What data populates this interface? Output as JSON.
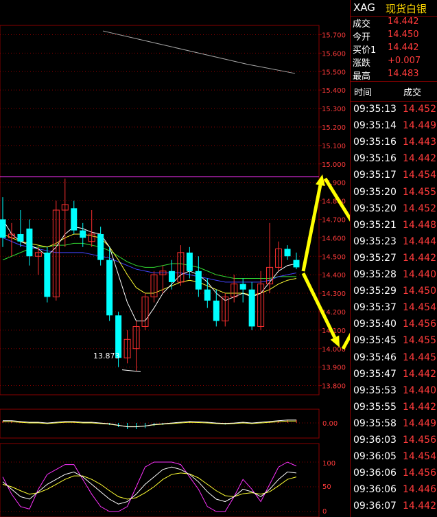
{
  "header": {
    "symbol": "XAG",
    "name": "现货白银"
  },
  "quote": [
    {
      "label": "成交",
      "value": "14.442"
    },
    {
      "label": "今开",
      "value": "14.450"
    },
    {
      "label": "买价1",
      "value": "14.442"
    },
    {
      "label": "涨跌",
      "value": "+0.007"
    },
    {
      "label": "最高",
      "value": "14.483"
    }
  ],
  "ticks_header": {
    "time": "时间",
    "price": "成交"
  },
  "ticks": [
    {
      "time": "09:35:13",
      "price": "14.452"
    },
    {
      "time": "09:35:14",
      "price": "14.449"
    },
    {
      "time": "09:35:16",
      "price": "14.443"
    },
    {
      "time": "09:35:16",
      "price": "14.442"
    },
    {
      "time": "09:35:17",
      "price": "14.454"
    },
    {
      "time": "09:35:20",
      "price": "14.455"
    },
    {
      "time": "09:35:20",
      "price": "14.452"
    },
    {
      "time": "09:35:21",
      "price": "14.448"
    },
    {
      "time": "09:35:23",
      "price": "14.444"
    },
    {
      "time": "09:35:27",
      "price": "14.442"
    },
    {
      "time": "09:35:28",
      "price": "14.440"
    },
    {
      "time": "09:35:29",
      "price": "14.450"
    },
    {
      "time": "09:35:37",
      "price": "14.454"
    },
    {
      "time": "09:35:40",
      "price": "14.456"
    },
    {
      "time": "09:35:45",
      "price": "14.455"
    },
    {
      "time": "09:35:46",
      "price": "14.445"
    },
    {
      "time": "09:35:47",
      "price": "14.442"
    },
    {
      "time": "09:35:53",
      "price": "14.440"
    },
    {
      "time": "09:35:55",
      "price": "14.442"
    },
    {
      "time": "09:35:58",
      "price": "14.449"
    },
    {
      "time": "09:36:03",
      "price": "14.456"
    },
    {
      "time": "09:36:05",
      "price": "14.454"
    },
    {
      "time": "09:36:06",
      "price": "14.456"
    },
    {
      "time": "09:36:06",
      "price": "14.446"
    },
    {
      "time": "09:36:07",
      "price": "14.442"
    }
  ],
  "chart": {
    "price_axis": [
      "15.700",
      "15.600",
      "15.500",
      "15.400",
      "15.300",
      "15.200",
      "15.100",
      "15.000",
      "14.900",
      "14.800",
      "14.700",
      "14.600",
      "14.500",
      "14.400",
      "14.300",
      "14.200",
      "14.100",
      "14.000",
      "13.900",
      "13.800"
    ],
    "low_label": "13.873",
    "macd_axis": [
      "0.00"
    ],
    "kdj_axis": [
      "100",
      "50",
      "0"
    ],
    "colors": {
      "up": "#ff3030",
      "down": "#00ffff",
      "grid": "#8a0000",
      "arrow": "#ffff00"
    }
  },
  "chart_data": {
    "type": "candlestick",
    "ylim": [
      13.75,
      15.75
    ],
    "candles": [
      {
        "o": 14.7,
        "h": 14.82,
        "l": 14.55,
        "c": 14.6
      },
      {
        "o": 14.6,
        "h": 14.68,
        "l": 14.5,
        "c": 14.62
      },
      {
        "o": 14.62,
        "h": 14.75,
        "l": 14.55,
        "c": 14.58
      },
      {
        "o": 14.65,
        "h": 14.7,
        "l": 14.45,
        "c": 14.5
      },
      {
        "o": 14.5,
        "h": 14.55,
        "l": 14.4,
        "c": 14.52
      },
      {
        "o": 14.52,
        "h": 14.55,
        "l": 14.25,
        "c": 14.28
      },
      {
        "o": 14.28,
        "h": 14.8,
        "l": 14.26,
        "c": 14.75
      },
      {
        "o": 14.75,
        "h": 14.92,
        "l": 14.55,
        "c": 14.78
      },
      {
        "o": 14.76,
        "h": 14.8,
        "l": 14.62,
        "c": 14.64
      },
      {
        "o": 14.64,
        "h": 14.68,
        "l": 14.55,
        "c": 14.6
      },
      {
        "o": 14.58,
        "h": 14.75,
        "l": 14.55,
        "c": 14.62
      },
      {
        "o": 14.62,
        "h": 14.66,
        "l": 14.45,
        "c": 14.48
      },
      {
        "o": 14.48,
        "h": 14.55,
        "l": 14.15,
        "c": 14.18
      },
      {
        "o": 14.18,
        "h": 14.2,
        "l": 13.9,
        "c": 13.95
      },
      {
        "o": 13.95,
        "h": 14.1,
        "l": 13.92,
        "c": 14.05
      },
      {
        "o": 14.0,
        "h": 14.15,
        "l": 13.88,
        "c": 14.12
      },
      {
        "o": 14.12,
        "h": 14.3,
        "l": 14.1,
        "c": 14.28
      },
      {
        "o": 14.28,
        "h": 14.42,
        "l": 14.25,
        "c": 14.4
      },
      {
        "o": 14.4,
        "h": 14.45,
        "l": 14.3,
        "c": 14.42
      },
      {
        "o": 14.42,
        "h": 14.48,
        "l": 14.32,
        "c": 14.36
      },
      {
        "o": 14.36,
        "h": 14.56,
        "l": 14.34,
        "c": 14.52
      },
      {
        "o": 14.52,
        "h": 14.55,
        "l": 14.38,
        "c": 14.42
      },
      {
        "o": 14.42,
        "h": 14.5,
        "l": 14.28,
        "c": 14.32
      },
      {
        "o": 14.32,
        "h": 14.38,
        "l": 14.22,
        "c": 14.26
      },
      {
        "o": 14.26,
        "h": 14.32,
        "l": 14.12,
        "c": 14.15
      },
      {
        "o": 14.15,
        "h": 14.3,
        "l": 14.12,
        "c": 14.28
      },
      {
        "o": 14.28,
        "h": 14.4,
        "l": 14.25,
        "c": 14.35
      },
      {
        "o": 14.35,
        "h": 14.38,
        "l": 14.25,
        "c": 14.32
      },
      {
        "o": 14.32,
        "h": 14.36,
        "l": 14.1,
        "c": 14.12
      },
      {
        "o": 14.12,
        "h": 14.42,
        "l": 14.1,
        "c": 14.35
      },
      {
        "o": 14.35,
        "h": 14.68,
        "l": 14.3,
        "c": 14.44
      },
      {
        "o": 14.44,
        "h": 14.58,
        "l": 14.42,
        "c": 14.54
      },
      {
        "o": 14.54,
        "h": 14.56,
        "l": 14.48,
        "c": 14.5
      },
      {
        "o": 14.48,
        "h": 14.52,
        "l": 14.43,
        "c": 14.44
      }
    ],
    "ma_upper": [
      15.72,
      15.66,
      15.6,
      15.54,
      15.49
    ],
    "ma_magenta_level": 14.93,
    "ma_fast": [
      14.7,
      14.62,
      14.58,
      14.56,
      14.54,
      14.5,
      14.55,
      14.62,
      14.66,
      14.65,
      14.63,
      14.62,
      14.55,
      14.4,
      14.25,
      14.15,
      14.15,
      14.22,
      14.3,
      14.35,
      14.4,
      14.42,
      14.4,
      14.36,
      14.3,
      14.26,
      14.28,
      14.3,
      14.28,
      14.3,
      14.36,
      14.42,
      14.45,
      14.46
    ],
    "ma_mid": [
      14.62,
      14.6,
      14.58,
      14.57,
      14.56,
      14.55,
      14.57,
      14.6,
      14.62,
      14.62,
      14.61,
      14.6,
      14.55,
      14.48,
      14.4,
      14.33,
      14.3,
      14.3,
      14.32,
      14.34,
      14.36,
      14.37,
      14.36,
      14.34,
      14.32,
      14.3,
      14.3,
      14.3,
      14.29,
      14.3,
      14.32,
      14.35,
      14.37,
      14.38
    ],
    "ma_blue": [
      14.6,
      14.58,
      14.56,
      14.55,
      14.54,
      14.53,
      14.52,
      14.52,
      14.52,
      14.52,
      14.51,
      14.5,
      14.49,
      14.47,
      14.45,
      14.43,
      14.42,
      14.41,
      14.41,
      14.41,
      14.41,
      14.4,
      14.39,
      14.38,
      14.37,
      14.36,
      14.36,
      14.36,
      14.36,
      14.36,
      14.37,
      14.39,
      14.4,
      14.41
    ],
    "ma_green": [
      14.48,
      14.5,
      14.52,
      14.54,
      14.55,
      14.55,
      14.56,
      14.56,
      14.57,
      14.57,
      14.56,
      14.55,
      14.53,
      14.5,
      14.47,
      14.45,
      14.44,
      14.44,
      14.45,
      14.46,
      14.46,
      14.45,
      14.44,
      14.42,
      14.4,
      14.39,
      14.38,
      14.38,
      14.38,
      14.38,
      14.38,
      14.39,
      14.39,
      14.39
    ],
    "macd_hist": [
      0.01,
      0.01,
      0.005,
      0,
      0,
      -0.005,
      0,
      0.005,
      0.005,
      0,
      0,
      -0.005,
      -0.01,
      -0.02,
      -0.03,
      -0.03,
      -0.025,
      -0.015,
      -0.01,
      -0.005,
      0,
      0.005,
      0.003,
      0,
      -0.005,
      -0.008,
      -0.005,
      0,
      -0.005,
      0,
      0.005,
      0.01,
      0.015,
      0.015
    ],
    "kdj_k": [
      60,
      45,
      30,
      25,
      40,
      55,
      65,
      75,
      80,
      70,
      55,
      40,
      25,
      15,
      20,
      35,
      55,
      70,
      85,
      90,
      85,
      75,
      60,
      40,
      25,
      20,
      30,
      45,
      40,
      30,
      45,
      65,
      80,
      78
    ],
    "kdj_d": [
      55,
      50,
      42,
      35,
      38,
      45,
      55,
      65,
      72,
      72,
      65,
      55,
      42,
      30,
      25,
      28,
      38,
      50,
      65,
      75,
      78,
      76,
      68,
      55,
      42,
      32,
      30,
      36,
      38,
      35,
      40,
      52,
      65,
      70
    ],
    "kdj_j": [
      70,
      35,
      10,
      5,
      45,
      75,
      85,
      95,
      95,
      65,
      35,
      10,
      0,
      0,
      10,
      50,
      90,
      100,
      100,
      100,
      95,
      70,
      45,
      10,
      0,
      0,
      30,
      65,
      45,
      20,
      55,
      90,
      100,
      92
    ]
  }
}
